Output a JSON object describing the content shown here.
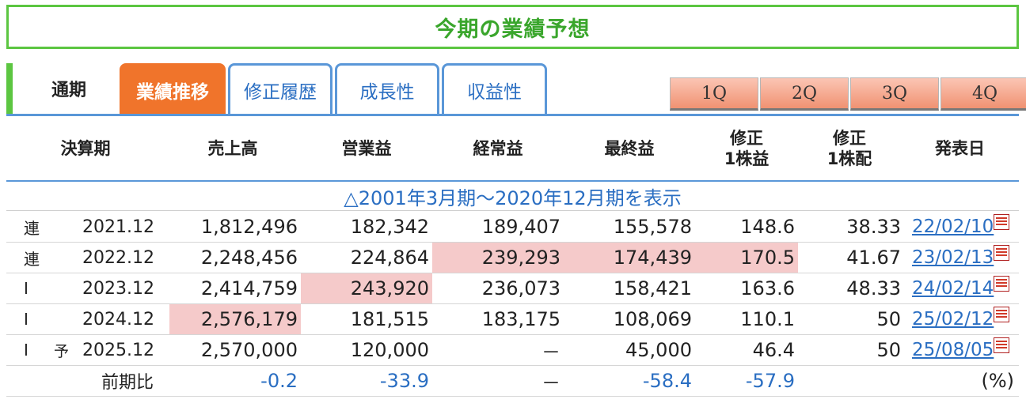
{
  "title": "今期の業績予想",
  "tabs": {
    "current": "通期",
    "items": [
      {
        "label": "業績推移",
        "active": true
      },
      {
        "label": "修正履歴",
        "active": false
      },
      {
        "label": "成長性",
        "active": false
      },
      {
        "label": "収益性",
        "active": false
      }
    ],
    "quarters": [
      "1Q",
      "2Q",
      "3Q",
      "4Q"
    ]
  },
  "table": {
    "headers": [
      "決算期",
      "売上高",
      "営業益",
      "経常益",
      "最終益",
      "修正\n1株益",
      "修正\n1株配",
      "発表日"
    ],
    "history_toggle": "△2001年3月期～2020年12月期を表示",
    "rows": [
      {
        "type": "連",
        "pre": "",
        "period": "2021.12",
        "sales": "1,812,496",
        "op": "182,342",
        "ord": "189,407",
        "net": "155,578",
        "eps": "148.6",
        "dps": "38.33",
        "date": "22/02/10"
      },
      {
        "type": "連",
        "pre": "",
        "period": "2022.12",
        "sales": "2,248,456",
        "op": "224,864",
        "ord": "239,293",
        "net": "174,439",
        "eps": "170.5",
        "dps": "41.67",
        "date": "23/02/13"
      },
      {
        "type": "I",
        "pre": "",
        "period": "2023.12",
        "sales": "2,414,759",
        "op": "243,920",
        "ord": "236,073",
        "net": "158,421",
        "eps": "163.6",
        "dps": "48.33",
        "date": "24/02/14"
      },
      {
        "type": "I",
        "pre": "",
        "period": "2024.12",
        "sales": "2,576,179",
        "op": "181,515",
        "ord": "183,175",
        "net": "108,069",
        "eps": "110.1",
        "dps": "50",
        "date": "25/02/12"
      },
      {
        "type": "I",
        "pre": "予",
        "period": "2025.12",
        "sales": "2,570,000",
        "op": "120,000",
        "ord": "－",
        "net": "45,000",
        "eps": "46.4",
        "dps": "50",
        "date": "25/08/05"
      }
    ],
    "comparison": {
      "label": "前期比",
      "sales": "-0.2",
      "op": "-33.9",
      "ord": "－",
      "net": "-58.4",
      "eps": "-57.9",
      "unit": "(%)"
    }
  },
  "colors": {
    "green": "#5cc641",
    "blue": "#5a97d8",
    "orange": "#f0742b",
    "highlight": "#f5caca"
  }
}
